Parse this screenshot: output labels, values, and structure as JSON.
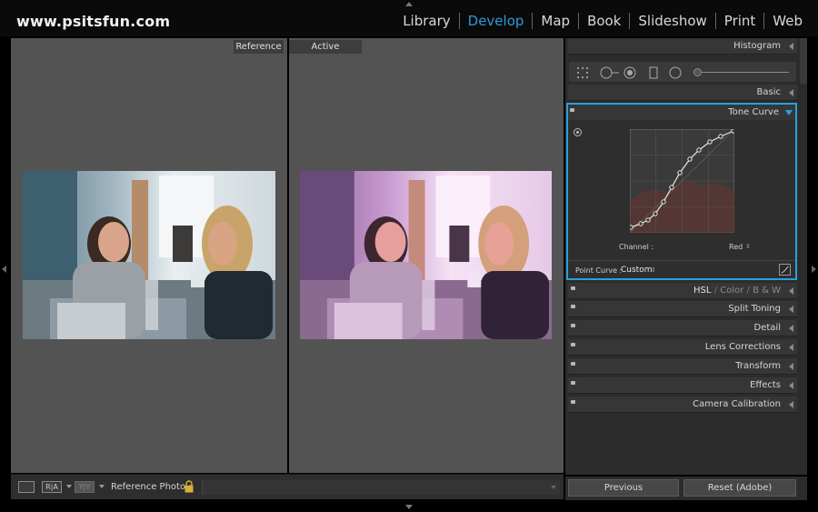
{
  "brand": "www.psitsfun.com",
  "modules": [
    {
      "label": "Library",
      "active": false
    },
    {
      "label": "Develop",
      "active": true
    },
    {
      "label": "Map",
      "active": false
    },
    {
      "label": "Book",
      "active": false
    },
    {
      "label": "Slideshow",
      "active": false
    },
    {
      "label": "Print",
      "active": false
    },
    {
      "label": "Web",
      "active": false
    }
  ],
  "viewer": {
    "reference_label": "Reference",
    "active_label": "Active"
  },
  "toolbar": {
    "view_button": "view-mode",
    "ra_label": "R|A",
    "yy_label": "Y|Y",
    "reference_photo_label": "Reference Photo :"
  },
  "panels": {
    "histogram": "Histogram",
    "basic": "Basic",
    "tone_curve": "Tone Curve",
    "hsl_parts": [
      "HSL",
      "Color",
      "B & W"
    ],
    "split_toning": "Split Toning",
    "detail": "Detail",
    "lens_corrections": "Lens Corrections",
    "transform": "Transform",
    "effects": "Effects",
    "camera_calibration": "Camera Calibration"
  },
  "tone_curve": {
    "channel_label": "Channel :",
    "channel_value": "Red",
    "point_curve_label": "Point Curve :",
    "point_curve_value": "Custom"
  },
  "buttons": {
    "previous": "Previous",
    "reset": "Reset (Adobe)"
  },
  "colors": {
    "accent": "#2f9bd8",
    "panel_bg": "#2c2c2c",
    "viewer_bg": "#535353"
  }
}
